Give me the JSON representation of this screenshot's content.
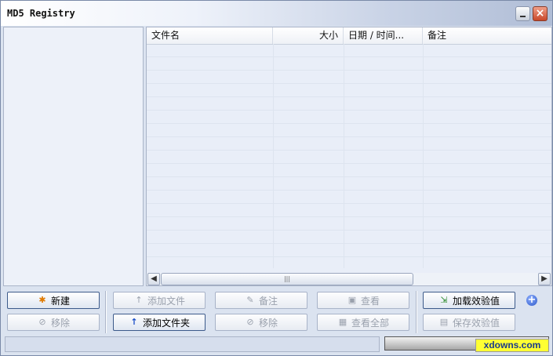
{
  "window": {
    "title": "MD5 Registry"
  },
  "list": {
    "columns": [
      {
        "label": "文件名"
      },
      {
        "label": "大小"
      },
      {
        "label": "日期 / 时间..."
      },
      {
        "label": "备注"
      }
    ]
  },
  "buttons": {
    "new": "新建",
    "remove_left": "移除",
    "add_file": "添加文件",
    "add_folder": "添加文件夹",
    "note": "备注",
    "remove": "移除",
    "view": "查看",
    "view_all": "查看全部",
    "load_checksum": "加载效验值",
    "save_checksum": "保存效验值"
  },
  "scrollbar": {
    "thumb_grip": "|||"
  },
  "watermark": "xdowns.com",
  "colors": {
    "accent": "#3c5a8a",
    "disabled_text": "#9aa1ad",
    "watermark_bg": "#ffff33"
  },
  "icons": {
    "new": "star-folder-icon",
    "remove": "remove-icon",
    "add_file": "arrow-up-icon",
    "add_folder": "arrow-up-icon",
    "note": "note-icon",
    "view": "view-icon",
    "view_all": "view-all-icon",
    "load": "load-icon",
    "save": "save-icon",
    "add_more": "plus-circle-icon"
  }
}
